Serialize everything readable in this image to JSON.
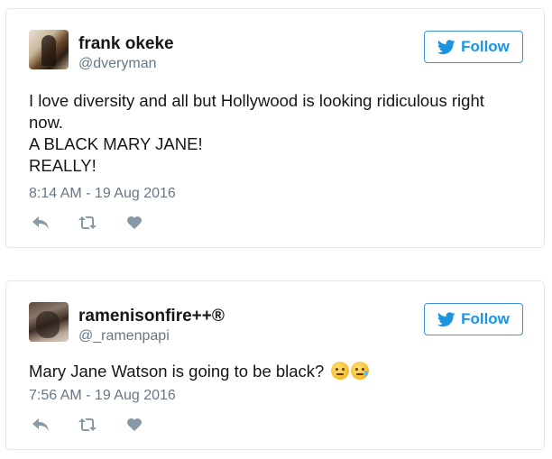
{
  "tweets": [
    {
      "display_name": "frank okeke",
      "handle": "@dveryman",
      "follow_label": "Follow",
      "text_lines": [
        "I love diversity and all but Hollywood is looking ridiculous right",
        "now.",
        "A BLACK MARY JANE!",
        "REALLY!"
      ],
      "timestamp": "8:14 AM - 19 Aug 2016",
      "actions": [
        "reply-icon",
        "retweet-icon",
        "like-icon"
      ]
    },
    {
      "display_name": "ramenisonfire++®",
      "handle": "@_ramenpapi",
      "follow_label": "Follow",
      "text_lines": [
        "Mary Jane Watson is going to be black?"
      ],
      "emojis": [
        "thinking-face-emoji",
        "sad-tear-face-emoji"
      ],
      "timestamp": "7:56 AM - 19 Aug 2016",
      "actions": [
        "reply-icon",
        "retweet-icon",
        "like-icon"
      ]
    }
  ],
  "colors": {
    "accent": "#1b95e0",
    "text": "#14171a",
    "muted": "#657786",
    "border": "#e1e8ed"
  }
}
